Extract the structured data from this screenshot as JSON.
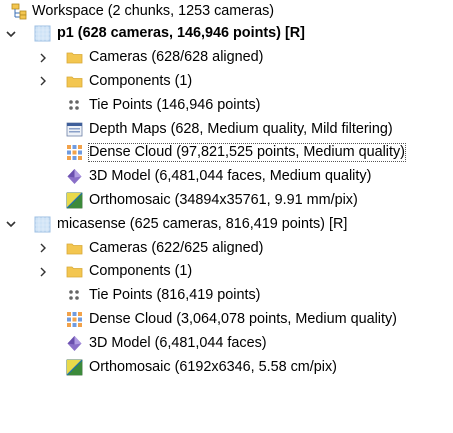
{
  "workspace": {
    "label": "Workspace (2 chunks, 1253 cameras)",
    "icon": "workspace-icon"
  },
  "chunks": [
    {
      "label": "p1 (628 cameras, 146,946 points) [R]",
      "icon": "chunk-icon",
      "bold": true,
      "expanded": true,
      "items": [
        {
          "label": "Cameras (628/628 aligned)",
          "icon": "folder-icon",
          "expandable": true
        },
        {
          "label": "Components (1)",
          "icon": "folder-icon",
          "expandable": true
        },
        {
          "label": "Tie Points (146,946 points)",
          "icon": "tie-points-icon",
          "expandable": false
        },
        {
          "label": "Depth Maps (628, Medium quality, Mild filtering)",
          "icon": "depth-maps-icon",
          "expandable": false
        },
        {
          "label": "Dense Cloud (97,821,525 points, Medium quality)",
          "icon": "dense-cloud-icon",
          "expandable": false,
          "focused": true
        },
        {
          "label": "3D Model (6,481,044 faces, Medium quality)",
          "icon": "3d-model-icon",
          "expandable": false
        },
        {
          "label": "Orthomosaic (34894x35761, 9.91 mm/pix)",
          "icon": "orthomosaic-icon",
          "expandable": false
        }
      ]
    },
    {
      "label": "micasense (625 cameras, 816,419 points) [R]",
      "icon": "chunk-icon",
      "bold": false,
      "expanded": true,
      "items": [
        {
          "label": "Cameras (622/625 aligned)",
          "icon": "folder-icon",
          "expandable": true
        },
        {
          "label": "Components (1)",
          "icon": "folder-icon",
          "expandable": true
        },
        {
          "label": "Tie Points (816,419 points)",
          "icon": "tie-points-icon",
          "expandable": false
        },
        {
          "label": "Dense Cloud (3,064,078 points, Medium quality)",
          "icon": "dense-cloud-icon",
          "expandable": false
        },
        {
          "label": "3D Model (6,481,044 faces)",
          "icon": "3d-model-icon",
          "expandable": false
        },
        {
          "label": "Orthomosaic (6192x6346, 5.58 cm/pix)",
          "icon": "orthomosaic-icon",
          "expandable": false
        }
      ]
    }
  ],
  "colors": {
    "folder": "#f3c650",
    "chunk": "#cfe3f6",
    "dense_cloud_a": "#f2a24a",
    "dense_cloud_b": "#6f9be0",
    "model": "#8a6fc8",
    "ortho": "#3c8a3a"
  }
}
